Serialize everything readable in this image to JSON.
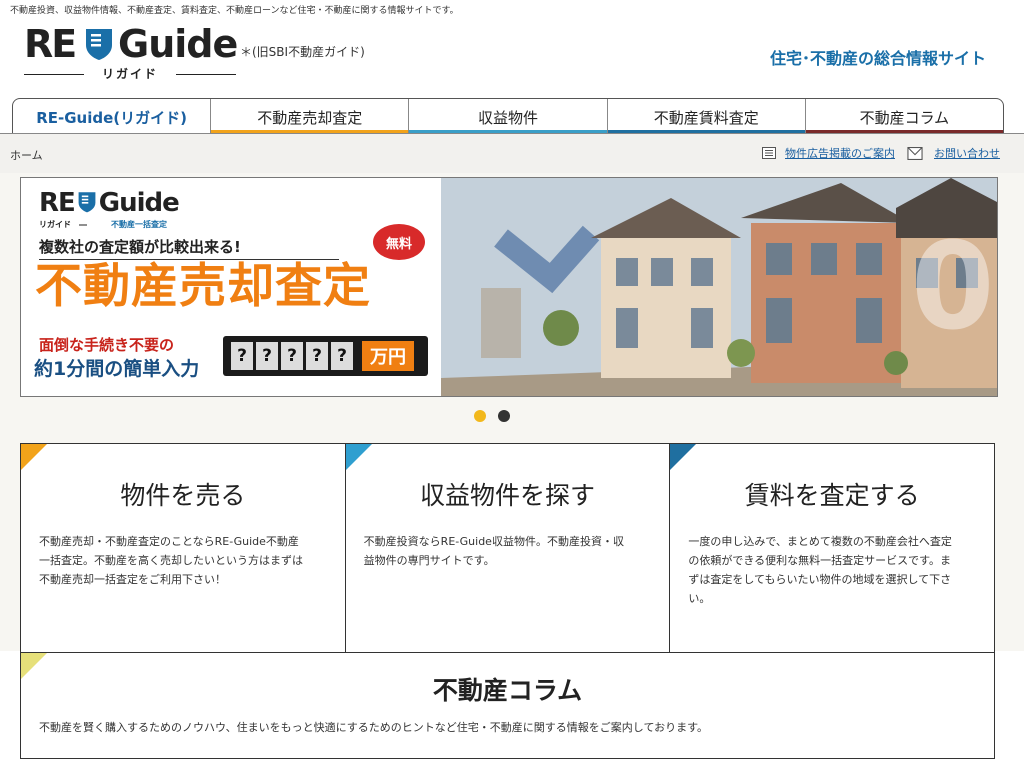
{
  "header": {
    "top_description": "不動産投資、収益物件情報、不動産査定、賃料査定、不動産ローンなど住宅・不動産に関する情報サイトです。",
    "logo_re": "RE",
    "logo_guide": "Guide",
    "logo_kana": "リガイド",
    "logo_note": "＊(旧SBI不動産ガイド)",
    "tagline": "住宅･不動産の総合情報サイト"
  },
  "nav": {
    "items": [
      {
        "label": "RE-Guide(リガイド)",
        "color": "#1a5fa0"
      },
      {
        "label": "不動産売却査定",
        "color": "#f2a31a"
      },
      {
        "label": "収益物件",
        "color": "#3a9fc8"
      },
      {
        "label": "不動産賃料査定",
        "color": "#1f6fa0"
      },
      {
        "label": "不動産コラム",
        "color": "#7a2a2a"
      }
    ]
  },
  "breadcrumb": {
    "home": "ホーム"
  },
  "utility": {
    "ad_link": "物件広告掲載のご案内",
    "contact_link": "お問い合わせ"
  },
  "banner": {
    "logo_re": "RE",
    "logo_guide": "Guide",
    "logo_kana": "リガイド　―",
    "logo_service": "不動産一括査定",
    "compare_text": "複数社の査定額が比較出来る!",
    "free_badge": "無料",
    "main_title": "不動産売却査定",
    "easy_line1": "面倒な手続き不要の",
    "easy_line2": "約1分間の簡単入力",
    "counter_digits": [
      "?",
      "?",
      "?",
      "?",
      "?"
    ],
    "counter_unit": "万円",
    "slide_count": 2,
    "active_slide": 1
  },
  "cards": [
    {
      "title": "物件を売る",
      "text": "不動産売却・不動産査定のことならRE-Guide不動産一括査定。不動産を高く売却したいという方はまずは不動産売却一括査定をご利用下さい！",
      "corner_color": "#f2a31a"
    },
    {
      "title": "収益物件を探す",
      "text": "不動産投資ならRE-Guide収益物件。不動産投資・収益物件の専門サイトです。",
      "corner_color": "#2f9fd0"
    },
    {
      "title": "賃料を査定する",
      "text": "一度の申し込みで、まとめて複数の不動産会社へ査定の依頼ができる便利な無料一括査定サービスです。まずは査定をしてもらいたい物件の地域を選択して下さい。",
      "corner_color": "#1f6fa0"
    }
  ],
  "column": {
    "title": "不動産コラム",
    "text": "不動産を賢く購入するためのノウハウ、住まいをもっと快適にするためのヒントなど住宅・不動産に関する情報をご案内しております。",
    "corner_color": "#e6e07a"
  }
}
